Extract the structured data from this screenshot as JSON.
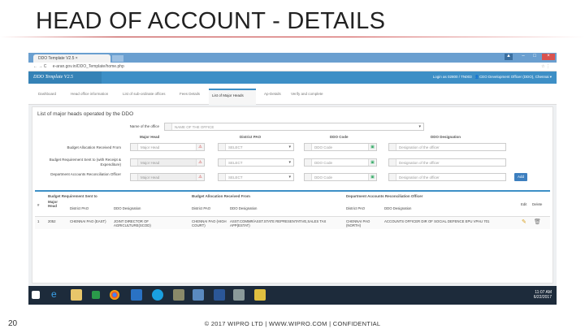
{
  "slide": {
    "title": "HEAD OF ACCOUNT - DETAILS",
    "page_number": "20",
    "footer": "© 2017 WIPRO LTD | WWW.WIPRO.COM | CONFIDENTIAL"
  },
  "browser": {
    "tab_title": "DDO Template V2.5",
    "url": "e-aran.gov.in/DDO_Template/home.php"
  },
  "app": {
    "brand": "DDO Template V2.5",
    "user_code": "Login as 02800 / TN003",
    "user_name": "CEO Development Officer (DDO), Chennai"
  },
  "nav": [
    "Dashboard",
    "Head office information",
    "List of sub-ordinate offices",
    "Fees Details",
    "List of Major Heads",
    "Ap-Details",
    "Verify and complete"
  ],
  "form": {
    "section_title": "List of major heads operated by the DDO",
    "office_label": "Name of the office",
    "office_value": "NAME OF THE OFFICE",
    "col_headers": [
      "Major Head",
      "District PAO",
      "DDO Code",
      "DDO Designation"
    ],
    "rows": [
      {
        "label": "Budget Allocation Received From",
        "major_head": "Major Head",
        "pao": "SELECT",
        "ddo_code": "DDO Code",
        "designation": "Designation of the officer"
      },
      {
        "label": "Budget Requirement Sent to (with Receipt & Expenditure)",
        "major_head": "Major Head",
        "pao": "SELECT",
        "ddo_code": "DDO Code",
        "designation": "Designation of the officer"
      },
      {
        "label": "Department Accounts Reconciliation Officer",
        "major_head": "Major Head",
        "pao": "SELECT",
        "ddo_code": "DDO Code",
        "designation": "Designation of the officer"
      }
    ],
    "add_label": "Add"
  },
  "table": {
    "groups": [
      "Budget Requirement Sent to",
      "Budget Allocation Received From",
      "Department Accounts Reconciliation Officer"
    ],
    "headers": [
      "#",
      "Major Head",
      "District PAO",
      "DDO Designation",
      "District PAO",
      "DDO Designation",
      "District PAO",
      "DDO Designation",
      "Edit",
      "Delete"
    ],
    "rows": [
      [
        "1",
        "2052",
        "CHENNAI PAO (EAST)",
        "JOINT DIRECTOR OF AGRICULTURE(SCOD)",
        "CHENNAI PAO (HIGH COURT)",
        "ASST.COMMR/ASST.STATE REPRESENTATIVE,SALES TAX APP(ESTAT)",
        "CHENNAI PAO (NORTH)",
        "ACCOUNTS OFFICER DIR OF SOCIAL DEFENCE EPU VPAU 701"
      ]
    ]
  },
  "taskbar": {
    "time": "11:07 AM",
    "date": "6/22/2017"
  },
  "colors": {
    "accent": "#3d8fc6",
    "taskbar": "#1d2b3b"
  }
}
